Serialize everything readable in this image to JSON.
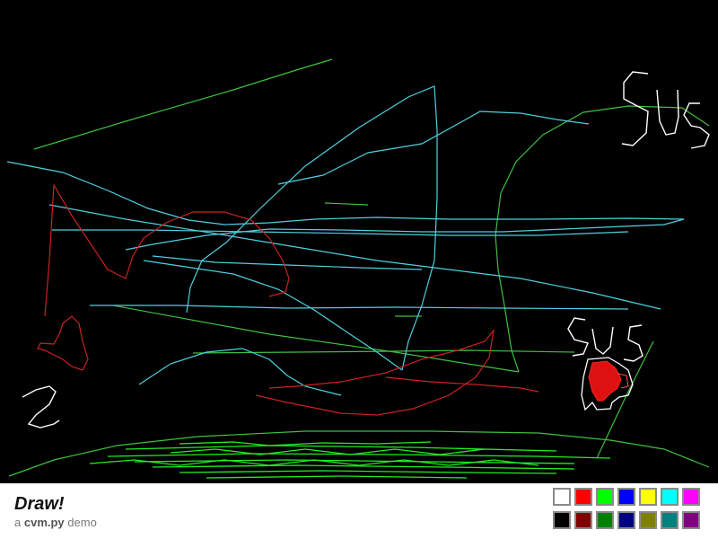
{
  "app": {
    "title": "Draw!",
    "subtitle_prefix": "a",
    "subtitle_lib": "cvm.py",
    "subtitle_suffix": "demo"
  },
  "canvas": {
    "background": "#000000",
    "handwritten_text": [
      "SUS",
      "SUS"
    ]
  },
  "palette": {
    "colors": [
      "#ffffff",
      "#ff0000",
      "#00ff00",
      "#0000ff",
      "#ffff00",
      "#00ffff",
      "#ff00ff",
      "#000000",
      "#800000",
      "#008000",
      "#000080",
      "#808000",
      "#008080",
      "#800080"
    ]
  }
}
